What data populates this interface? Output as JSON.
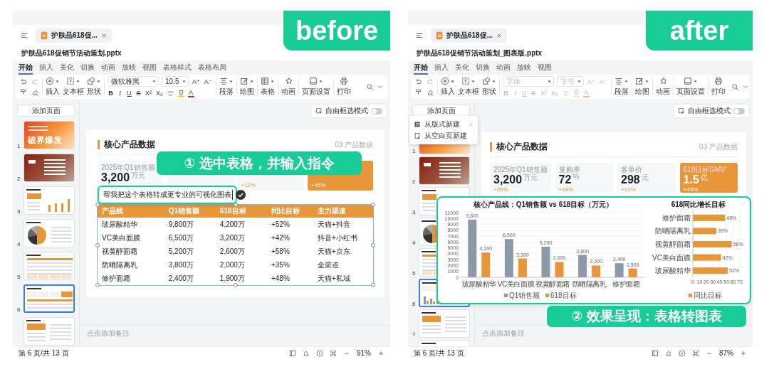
{
  "panels": [
    {
      "badge": "before",
      "doc_tab": "护肤品618促...",
      "file_name": "护肤品618促销节活动策划.pptx",
      "ribbon_tabs": [
        {
          "label": "开始",
          "selected": true
        },
        {
          "label": "插入",
          "selected": false
        },
        {
          "label": "美化",
          "selected": false
        },
        {
          "label": "切换",
          "selected": false
        },
        {
          "label": "动画",
          "selected": false
        },
        {
          "label": "放映",
          "selected": false
        },
        {
          "label": "视图",
          "selected": false
        },
        {
          "label": "表格样式",
          "selected": false
        },
        {
          "label": "表格布局",
          "selected": false
        }
      ],
      "ribbon": {
        "insert_tools": [
          {
            "kind": "insert",
            "label": "插入"
          },
          {
            "kind": "textbox",
            "label": "文本框"
          },
          {
            "kind": "shape",
            "label": "形状"
          }
        ],
        "font": {
          "value": "微软雅黑",
          "disabled": false
        },
        "size": {
          "value": "10.5",
          "disabled": false
        },
        "size_buttons": [
          {
            "label": "A⁺",
            "disabled": false
          },
          {
            "label": "A⁻",
            "disabled": false
          }
        ],
        "format_buttons": [
          {
            "kind": "bold",
            "label": "B",
            "disabled": false
          },
          {
            "kind": "italic",
            "label": "I",
            "disabled": false
          },
          {
            "kind": "underline",
            "label": "U",
            "disabled": false
          },
          {
            "kind": "strike",
            "label": "S",
            "disabled": false
          },
          {
            "kind": "superscript",
            "label": "X²",
            "disabled": false
          },
          {
            "kind": "subscript",
            "label": "X₂",
            "disabled": false
          },
          {
            "kind": "spacing",
            "disabled": false
          },
          {
            "kind": "highlight",
            "disabled": false
          },
          {
            "kind": "color",
            "label": "A",
            "disabled": false
          }
        ],
        "groups": [
          {
            "kind": "paragraph",
            "label": "段落"
          },
          {
            "kind": "draw",
            "label": "绘图"
          },
          {
            "kind": "table",
            "label": "表格"
          },
          {
            "kind": "animation",
            "label": "动画"
          },
          {
            "kind": "page-setup",
            "label": "页面设置"
          },
          {
            "kind": "print",
            "label": "打印"
          }
        ]
      },
      "add_page": "添加页面",
      "free_select": {
        "label": "自由框选模式",
        "on": false
      },
      "thumbnails": [
        {
          "number": "1",
          "kind": "cover",
          "text": "破界爆发",
          "selected": false
        },
        {
          "number": "2",
          "kind": "agenda",
          "selected": false
        },
        {
          "number": "3",
          "kind": "bars",
          "selected": false
        },
        {
          "number": "4",
          "kind": "pie",
          "selected": false
        },
        {
          "number": "5",
          "kind": "table",
          "selected": false
        },
        {
          "number": "6",
          "kind": "kpi-table",
          "selected": true
        },
        {
          "kind": "cards",
          "selected": false
        }
      ],
      "slide": {
        "title": "核心产品数据",
        "tag": "03 产品数据",
        "kpis": [
          {
            "label": "2025年Q1销售额",
            "value": "3,200",
            "unit": "万元",
            "highlight": false
          },
          {
            "highlight": false
          },
          {
            "change": "+12%",
            "highlight": false
          },
          {
            "change": "+45%",
            "highlight": true
          }
        ],
        "table": {
          "selected": true,
          "columns": [
            "产品线",
            "Q1销售额",
            "618目标",
            "同比目标",
            "主力渠道"
          ],
          "rows": [
            [
              "玻尿酸精华",
              "9,800万",
              "4,200万",
              "+52%",
              "天猫+抖音"
            ],
            [
              "VC美白面膜",
              "6,500万",
              "3,200万",
              "+42%",
              "抖音+小红书"
            ],
            [
              "视黄醇面霜",
              "5,200万",
              "2,600万",
              "+58%",
              "天猫+京东"
            ],
            [
              "防晒隔离乳",
              "3,800万",
              "2,000万",
              "+35%",
              "全渠道"
            ],
            [
              "修护面霜",
              "2,400万",
              "1,900万",
              "+48%",
              "天猫+私域"
            ]
          ]
        }
      },
      "prompt": {
        "value": "帮我把这个表格转成更专业的可视化图表"
      },
      "callout": "① 选中表格，并输入指令",
      "notes_placeholder": "点击添加备注",
      "status": {
        "page": "第 6 页/共 13 页",
        "zoom": "91%"
      }
    },
    {
      "badge": "after",
      "doc_tab": "护肤品618促...",
      "file_name": "护肤品618促销节活动策划_图表版.pptx",
      "ribbon_tabs": [
        {
          "label": "开始",
          "selected": true
        },
        {
          "label": "插入",
          "selected": false
        },
        {
          "label": "美化",
          "selected": false
        },
        {
          "label": "切换",
          "selected": false
        },
        {
          "label": "动画",
          "selected": false
        },
        {
          "label": "放映",
          "selected": false
        },
        {
          "label": "视图",
          "selected": false
        }
      ],
      "ribbon": {
        "insert_tools": [
          {
            "kind": "insert",
            "label": "插入"
          },
          {
            "kind": "textbox",
            "label": "文本框"
          },
          {
            "kind": "shape",
            "label": "形状"
          }
        ],
        "font": {
          "placeholder": "字体",
          "disabled": true
        },
        "size": {
          "placeholder": "字号",
          "disabled": true
        },
        "size_buttons": [
          {
            "label": "A⁺",
            "disabled": true
          },
          {
            "label": "A⁻",
            "disabled": true
          }
        ],
        "format_buttons": [
          {
            "kind": "bold",
            "label": "B",
            "disabled": true
          },
          {
            "kind": "italic",
            "label": "I",
            "disabled": true
          },
          {
            "kind": "underline",
            "label": "U",
            "disabled": true
          },
          {
            "kind": "strike",
            "label": "S",
            "disabled": true
          },
          {
            "kind": "superscript",
            "label": "X²",
            "disabled": true
          },
          {
            "kind": "subscript",
            "label": "X₂",
            "disabled": true
          },
          {
            "kind": "spacing",
            "disabled": true
          },
          {
            "kind": "highlight",
            "disabled": true
          },
          {
            "kind": "color",
            "label": "A",
            "disabled": true
          }
        ],
        "groups": [
          {
            "kind": "paragraph",
            "label": "段落"
          },
          {
            "kind": "draw",
            "label": "绘图"
          },
          {
            "kind": "animation",
            "label": "动画"
          },
          {
            "kind": "page-setup",
            "label": "页面设置"
          },
          {
            "kind": "print",
            "label": "打印"
          }
        ]
      },
      "add_page": "添加页面",
      "free_select": {
        "label": "自由框选模式",
        "on": false
      },
      "page_menu": [
        {
          "kind": "layout",
          "label": "从版式新建",
          "submenu": true
        },
        {
          "kind": "blank",
          "label": "从空白页新建",
          "submenu": false
        }
      ],
      "thumbnails": [
        {
          "number": "1",
          "kind": "cover",
          "selected": false
        },
        {
          "number": "2",
          "kind": "agenda",
          "selected": false
        },
        {
          "number": "3",
          "kind": "bars",
          "selected": false
        },
        {
          "number": "4",
          "kind": "pie",
          "selected": false
        },
        {
          "number": "5",
          "kind": "table",
          "selected": false
        },
        {
          "number": "6",
          "kind": "kpi-chart",
          "selected": true
        },
        {
          "number": "7",
          "kind": "cards",
          "selected": false
        },
        {
          "kind": "list",
          "selected": false
        }
      ],
      "slide": {
        "title": "核心产品数据",
        "tag": "03 产品数据",
        "kpis": [
          {
            "label": "2025年Q1销售额",
            "value": "3,200",
            "unit": "万元",
            "change": "+35%",
            "highlight": false
          },
          {
            "label": "复购率",
            "value": "72",
            "unit": "%",
            "change": "+18%",
            "highlight": false
          },
          {
            "label": "客单价",
            "value": "298",
            "unit": "元",
            "change": "+12%",
            "highlight": false
          },
          {
            "label": "618目标GMV",
            "value": "1.5",
            "unit": "亿",
            "change": "+45%",
            "highlight": true
          }
        ]
      },
      "chart_frame": {
        "charts": [
          {
            "chart_data": {
              "type": "bar",
              "title": "核心产品线：Q1销售额 vs 618目标（万元）",
              "categories": [
                "玻尿酸精华",
                "VC美白面膜",
                "视黄醇面霜",
                "防晒隔离乳",
                "修护面霜"
              ],
              "series": [
                {
                  "name": "Q1销售额",
                  "color": "#8c99aa",
                  "values": [
                    9800,
                    6500,
                    5200,
                    3800,
                    2400
                  ],
                  "value_labels": [
                    "9,800",
                    "6,500",
                    "5,200",
                    "3,800",
                    "2,400"
                  ]
                },
                {
                  "name": "618目标",
                  "color": "#e8963a",
                  "values": [
                    4200,
                    3200,
                    2600,
                    2000,
                    1500
                  ],
                  "value_labels": [
                    "4,200",
                    "3,200",
                    "2,600",
                    "2,000",
                    "1,500"
                  ]
                }
              ],
              "grid": true,
              "legend": true,
              "ylim": [
                0,
                11000
              ],
              "yticks": [
                0,
                1000,
                2000,
                3000,
                4000,
                5000,
                6000,
                7000,
                8000,
                9000,
                10000,
                11000
              ]
            }
          },
          {
            "chart_data": {
              "type": "bar",
              "orientation": "horizontal",
              "title": "618同比增长目标",
              "categories": [
                "修护面霜",
                "防晒隔离乳",
                "视黄醇面霜",
                "VC美白面膜",
                "玻尿酸精华"
              ],
              "series": [
                {
                  "name": "同比目标",
                  "color": "#e8963a",
                  "values": [
                    48,
                    35,
                    58,
                    42,
                    52
                  ],
                  "value_labels": [
                    "48%",
                    "35%",
                    "58%",
                    "42%",
                    "52%"
                  ]
                }
              ],
              "grid": true,
              "legend": true,
              "xlim": [
                0,
                70
              ],
              "xticks": [
                0,
                10,
                20,
                30,
                40,
                50,
                60,
                70
              ]
            }
          }
        ]
      },
      "callout": "② 效果呈现：表格转图表",
      "notes_placeholder": "点击添加备注",
      "status": {
        "page": "第 6 页/共 13 页",
        "zoom": "87%"
      }
    }
  ]
}
